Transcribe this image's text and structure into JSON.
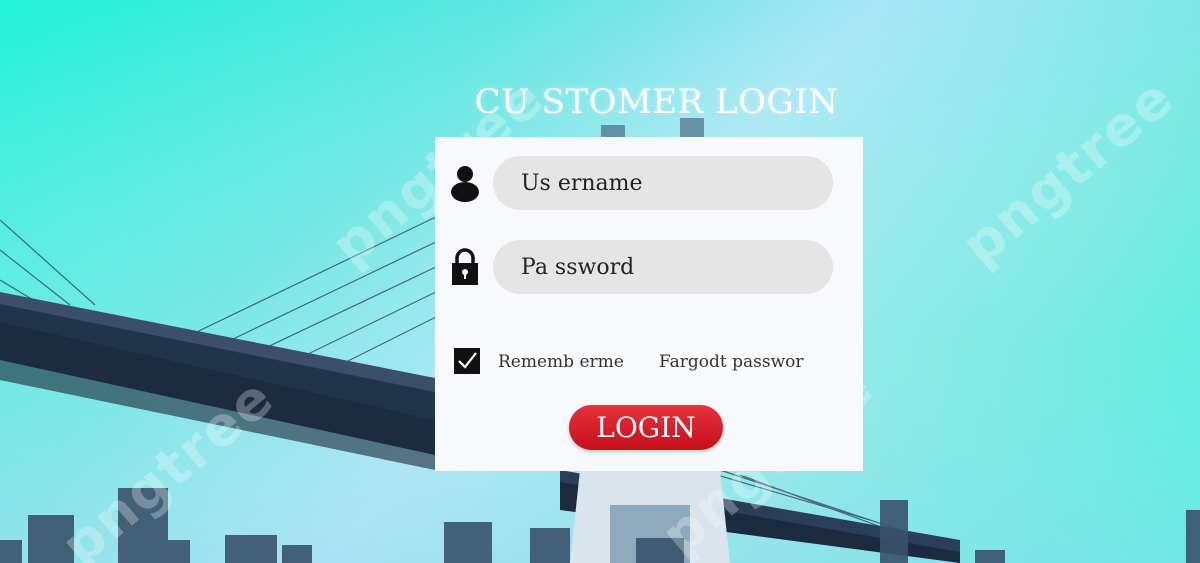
{
  "watermark": {
    "text": "pngtree"
  },
  "login": {
    "title": "CU STOMER LOGIN",
    "username_placeholder": "Us ername",
    "password_placeholder": "Pa ssword",
    "remember_label": "Rememb erme",
    "remember_checked": true,
    "forgot_label": "Fargodt passwor",
    "login_label": "LOGIN"
  },
  "icons": {
    "username": "user-icon",
    "password": "lock-icon",
    "remember": "checkbox-check-icon"
  },
  "colors": {
    "login_button": "#d51622",
    "card_background": "#f7f9fc",
    "input_background": "#e5e5e5",
    "title_text": "#ffffff"
  }
}
